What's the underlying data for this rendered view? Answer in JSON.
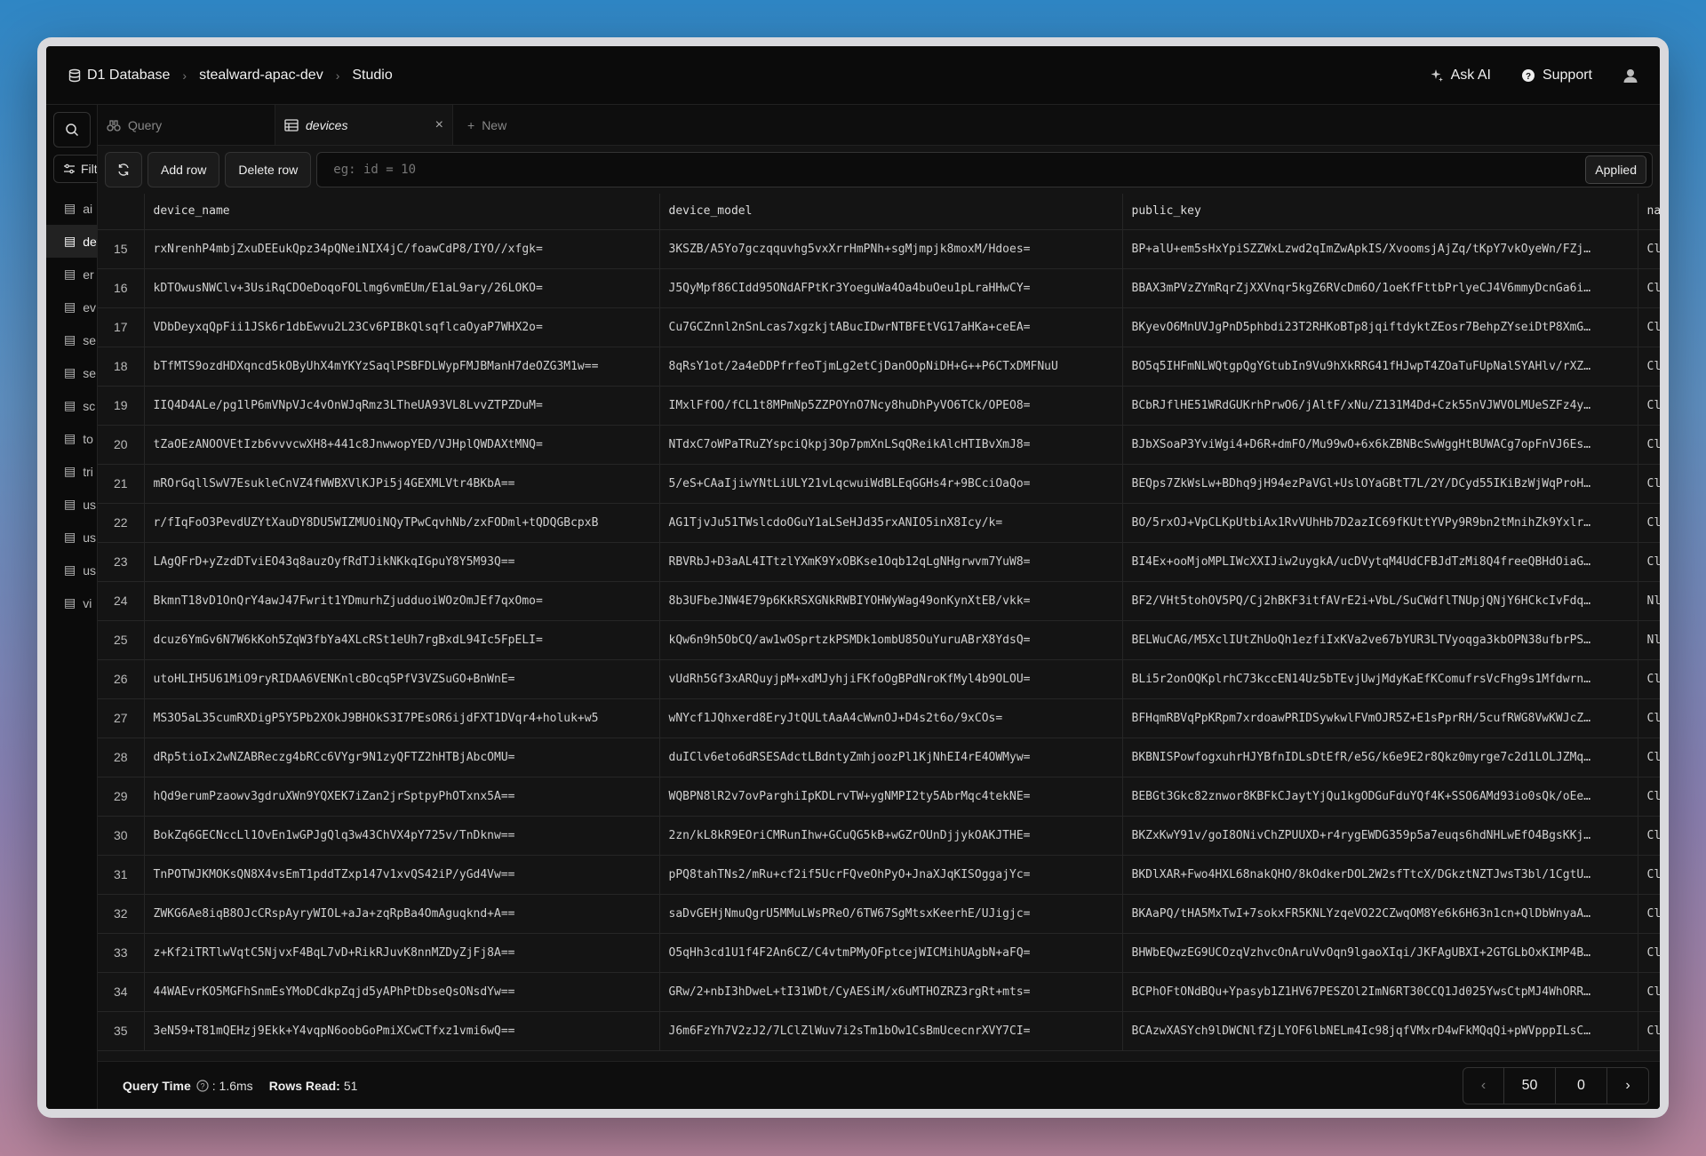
{
  "breadcrumb": {
    "root": "D1 Database",
    "database": "stealward-apac-dev",
    "page": "Studio"
  },
  "header": {
    "ask_ai": "Ask AI",
    "support": "Support"
  },
  "sidebar": {
    "filter_label": "Filter",
    "items": [
      {
        "label": "ai"
      },
      {
        "label": "devices"
      },
      {
        "label": "er"
      },
      {
        "label": "ev"
      },
      {
        "label": "se"
      },
      {
        "label": "se"
      },
      {
        "label": "sc"
      },
      {
        "label": "to"
      },
      {
        "label": "tri"
      },
      {
        "label": "us"
      },
      {
        "label": "us"
      },
      {
        "label": "us"
      },
      {
        "label": "vi"
      }
    ]
  },
  "tabs": {
    "query": "Query",
    "devices": "devices",
    "new": "New"
  },
  "toolbar": {
    "add_row": "Add row",
    "delete_row": "Delete row",
    "filter_placeholder": "eg: id = 10",
    "applied": "Applied"
  },
  "table": {
    "columns": [
      "device_name",
      "device_model",
      "public_key",
      "na"
    ],
    "rows": [
      {
        "n": "15",
        "device_name": "rxNrenhP4mbjZxuDEEukQpz34pQNeiNIX4jC/foawCdP8/IYO//xfgk=",
        "device_model": "3KSZB/A5Yo7gczqquvhg5vxXrrHmPNh+sgMjmpjk8moxM/Hdoes=",
        "public_key": "BP+alU+em5sHxYpiSZZWxLzwd2qImZwApkIS/XvoomsjAjZq/tKpY7vkOyeWn/FZj…",
        "extra": "Cl"
      },
      {
        "n": "16",
        "device_name": "kDTOwusNWClv+3UsiRqCDOeDoqoFOLlmg6vmEUm/E1aL9ary/26LOKO=",
        "device_model": "J5QyMpf86CIdd95ONdAFPtKr3YoeguWa4Oa4buOeu1pLraHHwCY=",
        "public_key": "BBAX3mPVzZYmRqrZjXXVnqr5kgZ6RVcDm6O/1oeKfFttbPrlyeCJ4V6mmyDcnGa6i…",
        "extra": "Cl"
      },
      {
        "n": "17",
        "device_name": "VDbDeyxqQpFii1JSk6r1dbEwvu2L23Cv6PIBkQlsqflcaOyaP7WHX2o=",
        "device_model": "Cu7GCZnnl2nSnLcas7xgzkjtABucIDwrNTBFEtVG17aHKa+ceEA=",
        "public_key": "BKyevO6MnUVJgPnD5phbdi23T2RHKoBTp8jqiftdyktZEosr7BehpZYseiDtP8XmG…",
        "extra": "Cl"
      },
      {
        "n": "18",
        "device_name": "bTfMTS9ozdHDXqncd5kOByUhX4mYKYzSaqlPSBFDLWypFMJBManH7deOZG3M1w==",
        "device_model": "8qRsY1ot/2a4eDDPfrfeoTjmLg2etCjDanOOpNiDH+G++P6CTxDMFNuU",
        "public_key": "BO5q5IHFmNLWQtgpQgYGtubIn9Vu9hXkRRG41fHJwpT4ZOaTuFUpNalSYAHlv/rXZ…",
        "extra": "Cl"
      },
      {
        "n": "19",
        "device_name": "IIQ4D4ALe/pg1lP6mVNpVJc4vOnWJqRmz3LTheUA93VL8LvvZTPZDuM=",
        "device_model": "IMxlFfOO/fCL1t8MPmNp5ZZPOYnO7Ncy8huDhPyVO6TCk/OPEO8=",
        "public_key": "BCbRJflHE51WRdGUKrhPrwO6/jAltF/xNu/Z131M4Dd+Czk55nVJWVOLMUeSZFz4y…",
        "extra": "Cl"
      },
      {
        "n": "20",
        "device_name": "tZaOEzANOOVEtIzb6vvvcwXH8+441c8JnwwopYED/VJHplQWDAXtMNQ=",
        "device_model": "NTdxC7oWPaTRuZYspciQkpj3Op7pmXnLSqQReikAlcHTIBvXmJ8=",
        "public_key": "BJbXSoaP3YviWgi4+D6R+dmFO/Mu99wO+6x6kZBNBcSwWggHtBUWACg7opFnVJ6Es…",
        "extra": "Cl"
      },
      {
        "n": "21",
        "device_name": "mROrGqllSwV7EsukleCnVZ4fWWBXVlKJPi5j4GEXMLVtr4BKbA==",
        "device_model": "5/eS+CAaIjiwYNtLiULY21vLqcwuiWdBLEqGGHs4r+9BCciOaQo=",
        "public_key": "BEQps7ZkWsLw+BDhq9jH94ezPaVGl+UslOYaGBtT7L/2Y/DCyd55IKiBzWjWqProH…",
        "extra": "Cl"
      },
      {
        "n": "22",
        "device_name": "r/fIqFoO3PevdUZYtXauDY8DU5WIZMUOiNQyTPwCqvhNb/zxFODml+tQDQGBcpxB",
        "device_model": "AG1TjvJu51TWslcdoOGuY1aLSeHJd35rxANIO5inX8Icy/k=",
        "public_key": "BO/5rxOJ+VpCLKpUtbiAx1RvVUhHb7D2azIC69fKUttYVPy9R9bn2tMnihZk9Yxlr…",
        "extra": "Cl"
      },
      {
        "n": "23",
        "device_name": "LAgQFrD+yZzdDTviEO43q8auzOyfRdTJikNKkqIGpuY8Y5M93Q==",
        "device_model": "RBVRbJ+D3aAL4ITtzlYXmK9YxOBKse1Oqb12qLgNHgrwvm7YuW8=",
        "public_key": "BI4Ex+ooMjoMPLIWcXXIJiw2uygkA/ucDVytqM4UdCFBJdTzMi8Q4freeQBHdOiaG…",
        "extra": "Cl"
      },
      {
        "n": "24",
        "device_name": "BkmnT18vD1OnQrY4awJ47Fwrit1YDmurhZjudduoiWOzOmJEf7qxOmo=",
        "device_model": "8b3UFbeJNW4E79p6KkRSXGNkRWBIYOHWyWag49onKynXtEB/vkk=",
        "public_key": "BF2/VHt5tohOV5PQ/Cj2hBKF3itfAVrE2i+VbL/SuCWdflTNUpjQNjY6HCkcIvFdq…",
        "extra": "Nl"
      },
      {
        "n": "25",
        "device_name": "dcuz6YmGv6N7W6kKoh5ZqW3fbYa4XLcRSt1eUh7rgBxdL94Ic5FpELI=",
        "device_model": "kQw6n9h5ObCQ/aw1wOSprtzkPSMDk1ombU85OuYuruABrX8YdsQ=",
        "public_key": "BELWuCAG/M5XclIUtZhUoQh1ezfiIxKVa2ve67bYUR3LTVyoqga3kbOPN38ufbrPS…",
        "extra": "Nl"
      },
      {
        "n": "26",
        "device_name": "utoHLIH5U61MiO9ryRIDAA6VENKnlcBOcq5PfV3VZSuGO+BnWnE=",
        "device_model": "vUdRh5Gf3xARQuyjpM+xdMJyhjiFKfoOgBPdNroKfMyl4b9OLOU=",
        "public_key": "BLi5r2onOQKplrhC73kccEN14Uz5bTEvjUwjMdyKaEfKComufrsVcFhg9s1Mfdwrn…",
        "extra": "Cl"
      },
      {
        "n": "27",
        "device_name": "MS3O5aL35cumRXDigP5Y5Pb2XOkJ9BHOkS3I7PEsOR6ijdFXT1DVqr4+holuk+w5",
        "device_model": "wNYcf1JQhxerd8EryJtQULtAaA4cWwnOJ+D4s2t6o/9xCOs=",
        "public_key": "BFHqmRBVqPpKRpm7xrdoawPRIDSywkwlFVmOJR5Z+E1sPprRH/5cufRWG8VwKWJcZ…",
        "extra": "Cl"
      },
      {
        "n": "28",
        "device_name": "dRp5tioIx2wNZABReczg4bRCc6VYgr9N1zyQFTZ2hHTBjAbcOMU=",
        "device_model": "duIClv6eto6dRSESAdctLBdntyZmhjoozPl1KjNhEI4rE4OWMyw=",
        "public_key": "BKBNISPowfogxuhrHJYBfnIDLsDtEfR/e5G/k6e9E2r8Qkz0myrge7c2d1LOLJZMq…",
        "extra": "Cl"
      },
      {
        "n": "29",
        "device_name": "hQd9erumPzaowv3gdruXWn9YQXEK7iZan2jrSptpyPhOTxnx5A==",
        "device_model": "WQBPN8lR2v7ovParghiIpKDLrvTW+ygNMPI2ty5AbrMqc4tekNE=",
        "public_key": "BEBGt3Gkc82znwor8KBFkCJaytYjQu1kgODGuFduYQf4K+SSO6AMd93io0sQk/oEe…",
        "extra": "Cl"
      },
      {
        "n": "30",
        "device_name": "BokZq6GECNccLl1OvEn1wGPJgQlq3w43ChVX4pY725v/TnDknw==",
        "device_model": "2zn/kL8kR9EOriCMRunIhw+GCuQG5kB+wGZrOUnDjjykOAKJTHE=",
        "public_key": "BKZxKwY91v/goI8ONivChZPUUXD+r4rygEWDG359p5a7euqs6hdNHLwEfO4BgsKKj…",
        "extra": "Cl"
      },
      {
        "n": "31",
        "device_name": "TnPOTWJKMOKsQN8X4vsEmT1pddTZxp147v1xvQS42iP/yGd4Vw==",
        "device_model": "pPQ8tahTNs2/mRu+cf2if5UcrFQveOhPyO+JnaXJqKISOggajYc=",
        "public_key": "BKDlXAR+Fwo4HXL68nakQHO/8kOdkerDOL2W2sfTtcX/DGkztNZTJwsT3bl/1CgtU…",
        "extra": "Cl"
      },
      {
        "n": "32",
        "device_name": "ZWKG6Ae8iqB8OJcCRspAyryWIOL+aJa+zqRpBa4OmAguqknd+A==",
        "device_model": "saDvGEHjNmuQgrU5MMuLWsPReO/6TW67SgMtsxKeerhE/UJigjc=",
        "public_key": "BKAaPQ/tHA5MxTwI+7sokxFR5KNLYzqeVO22CZwqOM8Ye6k6H63n1cn+QlDbWnyaA…",
        "extra": "Cl"
      },
      {
        "n": "33",
        "device_name": "z+Kf2iTRTlwVqtC5NjvxF4BqL7vD+RikRJuvK8nnMZDyZjFj8A==",
        "device_model": "O5qHh3cd1U1f4F2An6CZ/C4vtmPMyOFptcejWICMihUAgbN+aFQ=",
        "public_key": "BHWbEQwzEG9UCOzqVzhvcOnAruVvOqn9lgaoXIqi/JKFAgUBXI+2GTGLbOxKIMP4B…",
        "extra": "Cl"
      },
      {
        "n": "34",
        "device_name": "44WAEvrKO5MGFhSnmEsYMoDCdkpZqjd5yAPhPtDbseQsONsdYw==",
        "device_model": "GRw/2+nbI3hDweL+tI31WDt/CyAESiM/x6uMTHOZRZ3rgRt+mts=",
        "public_key": "BCPhOFtONdBQu+Ypasyb1Z1HV67PESZOl2ImN6RT30CCQ1Jd025YwsCtpMJ4WhORR…",
        "extra": "Cl"
      },
      {
        "n": "35",
        "device_name": "3eN59+T81mQEHzj9Ekk+Y4vqpN6oobGoPmiXCwCTfxz1vmi6wQ==",
        "device_model": "J6m6FzYh7V2zJ2/7LClZlWuv7i2sTm1bOw1CsBmUcecnrXVY7CI=",
        "public_key": "BCAzwXASYch9lDWCNlfZjLYOF6lbNELm4Ic98jqfVMxrD4wFkMQqQi+pWVpppILsC…",
        "extra": "Cl"
      }
    ]
  },
  "footer": {
    "query_time_label": "Query Time",
    "query_time_value": ": 1.6ms",
    "rows_read_label": "Rows Read:",
    "rows_read_value": "51",
    "limit": "50",
    "offset": "0"
  }
}
